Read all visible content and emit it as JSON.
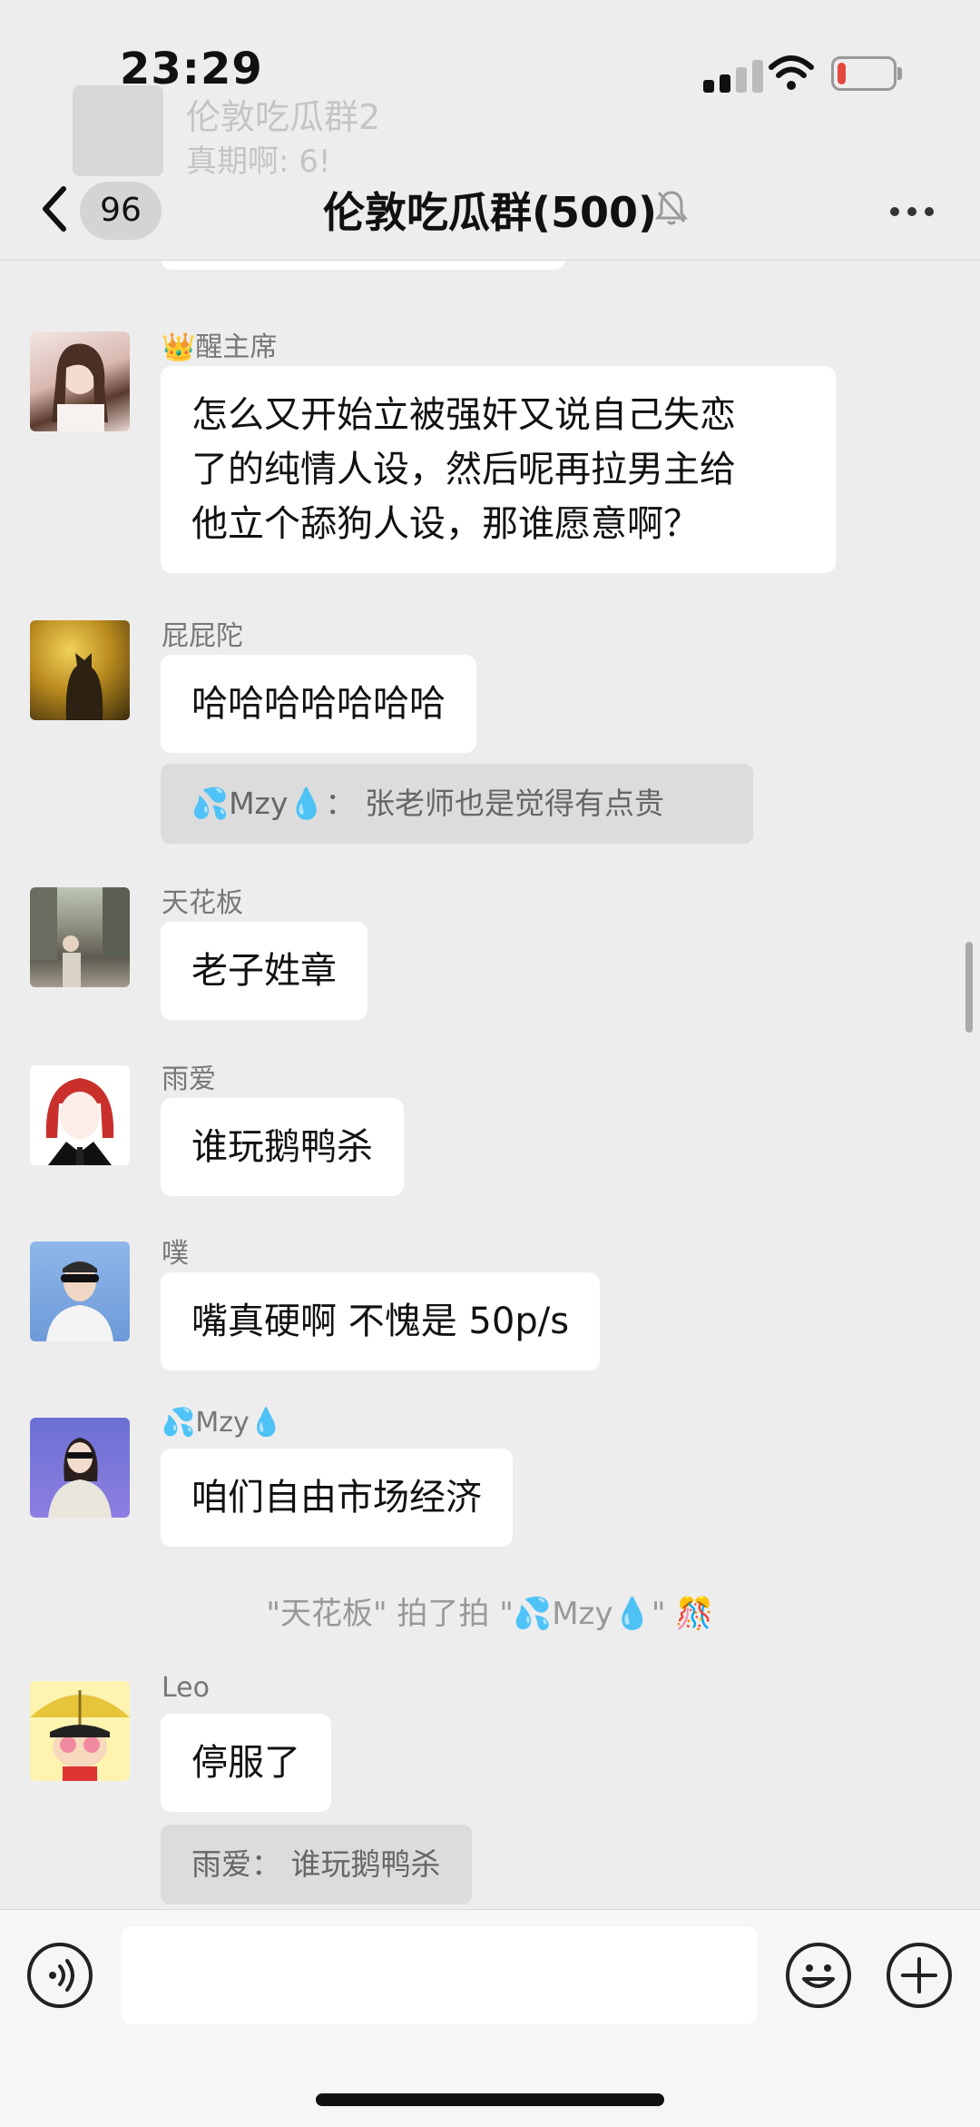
{
  "status_bar": {
    "time": "23:29",
    "battery_level": 0.15
  },
  "background_banner": {
    "title": "伦敦吃瓜群2",
    "preview": "真期啊: 6!"
  },
  "nav": {
    "unread_count": "96",
    "title": "伦敦吃瓜群(500)"
  },
  "messages": [
    {
      "sender": "👑醒主席",
      "text_lines": [
        "怎么又开始立被强奸又说自己失恋",
        "了的纯情人设，然后呢再拉男主给",
        "他立个舔狗人设，那谁愿意啊？"
      ]
    },
    {
      "sender": "屁屁陀",
      "text": "哈哈哈哈哈哈哈",
      "quote": "💦Mzy💧：  张老师也是觉得有点贵"
    },
    {
      "sender": "天花板",
      "text": "老子姓章"
    },
    {
      "sender": "雨爱",
      "text": "谁玩鹅鸭杀"
    },
    {
      "sender": "噗",
      "text": "嘴真硬啊 不愧是 50p/s"
    },
    {
      "sender": "💦Mzy💧",
      "text": "咱们自由市场经济"
    },
    {
      "sender": "Leo",
      "text": "停服了",
      "quote": "雨爱：  谁玩鹅鸭杀"
    }
  ],
  "system_message": "\"天花板\" 拍了拍 \"💦Mzy💧\" 🎊",
  "colors": {
    "bg": "#ededed",
    "bubble": "#ffffff",
    "quote_bg": "#dcdcdc",
    "battery": "#e34a3f"
  }
}
